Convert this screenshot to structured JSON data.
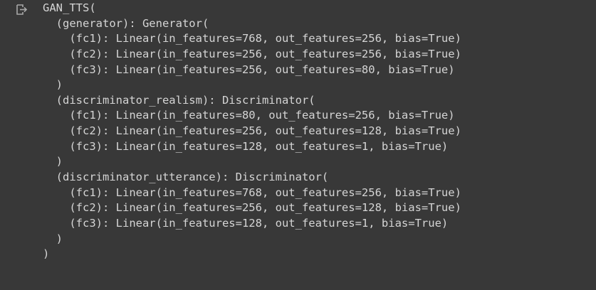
{
  "output": {
    "icon": "output-redirect-icon",
    "lines": [
      "GAN_TTS(",
      "  (generator): Generator(",
      "    (fc1): Linear(in_features=768, out_features=256, bias=True)",
      "    (fc2): Linear(in_features=256, out_features=256, bias=True)",
      "    (fc3): Linear(in_features=256, out_features=80, bias=True)",
      "  )",
      "  (discriminator_realism): Discriminator(",
      "    (fc1): Linear(in_features=80, out_features=256, bias=True)",
      "    (fc2): Linear(in_features=256, out_features=128, bias=True)",
      "    (fc3): Linear(in_features=128, out_features=1, bias=True)",
      "  )",
      "  (discriminator_utterance): Discriminator(",
      "    (fc1): Linear(in_features=768, out_features=256, bias=True)",
      "    (fc2): Linear(in_features=256, out_features=128, bias=True)",
      "    (fc3): Linear(in_features=128, out_features=1, bias=True)",
      "  )",
      ")"
    ]
  },
  "colors": {
    "background": "#383838",
    "text": "#d5d5d5",
    "icon": "#a8a8a8"
  }
}
